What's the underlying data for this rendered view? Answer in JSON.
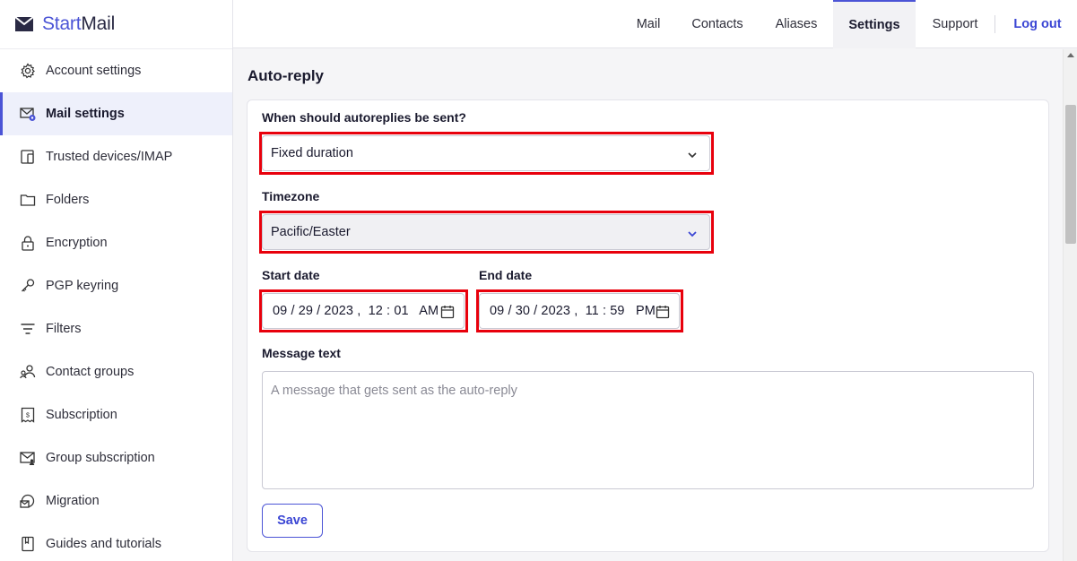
{
  "brand": {
    "part1": "Start",
    "part2": "Mail",
    "color": "#4b54d6"
  },
  "sidebar": {
    "items": [
      {
        "label": "Account settings",
        "icon": "gear-icon"
      },
      {
        "label": "Mail settings",
        "icon": "envelope-gear-icon",
        "active": true
      },
      {
        "label": "Trusted devices/IMAP",
        "icon": "devices-icon"
      },
      {
        "label": "Folders",
        "icon": "folder-icon"
      },
      {
        "label": "Encryption",
        "icon": "lock-icon"
      },
      {
        "label": "PGP keyring",
        "icon": "key-icon"
      },
      {
        "label": "Filters",
        "icon": "filter-icon"
      },
      {
        "label": "Contact groups",
        "icon": "contact-groups-icon"
      },
      {
        "label": "Subscription",
        "icon": "receipt-icon"
      },
      {
        "label": "Group subscription",
        "icon": "envelope-user-icon"
      },
      {
        "label": "Migration",
        "icon": "migration-icon"
      },
      {
        "label": "Guides and tutorials",
        "icon": "book-icon"
      }
    ]
  },
  "nav": {
    "mail": "Mail",
    "contacts": "Contacts",
    "aliases": "Aliases",
    "settings": "Settings",
    "support": "Support",
    "logout": "Log out"
  },
  "page": {
    "title": "Auto-reply"
  },
  "form": {
    "when_label": "When should autoreplies be sent?",
    "when_value": "Fixed duration",
    "timezone_label": "Timezone",
    "timezone_value": "Pacific/Easter",
    "start_label": "Start date",
    "start_value": "09 / 29 / 2023 ,  12 : 01   AM",
    "end_label": "End date",
    "end_value": "09 / 30 / 2023 ,  11 : 59   PM",
    "message_label": "Message text",
    "message_placeholder": "A message that gets sent as the auto-reply",
    "save_label": "Save"
  },
  "colors": {
    "accent": "#4b54d6",
    "highlight": "#e8000c"
  }
}
